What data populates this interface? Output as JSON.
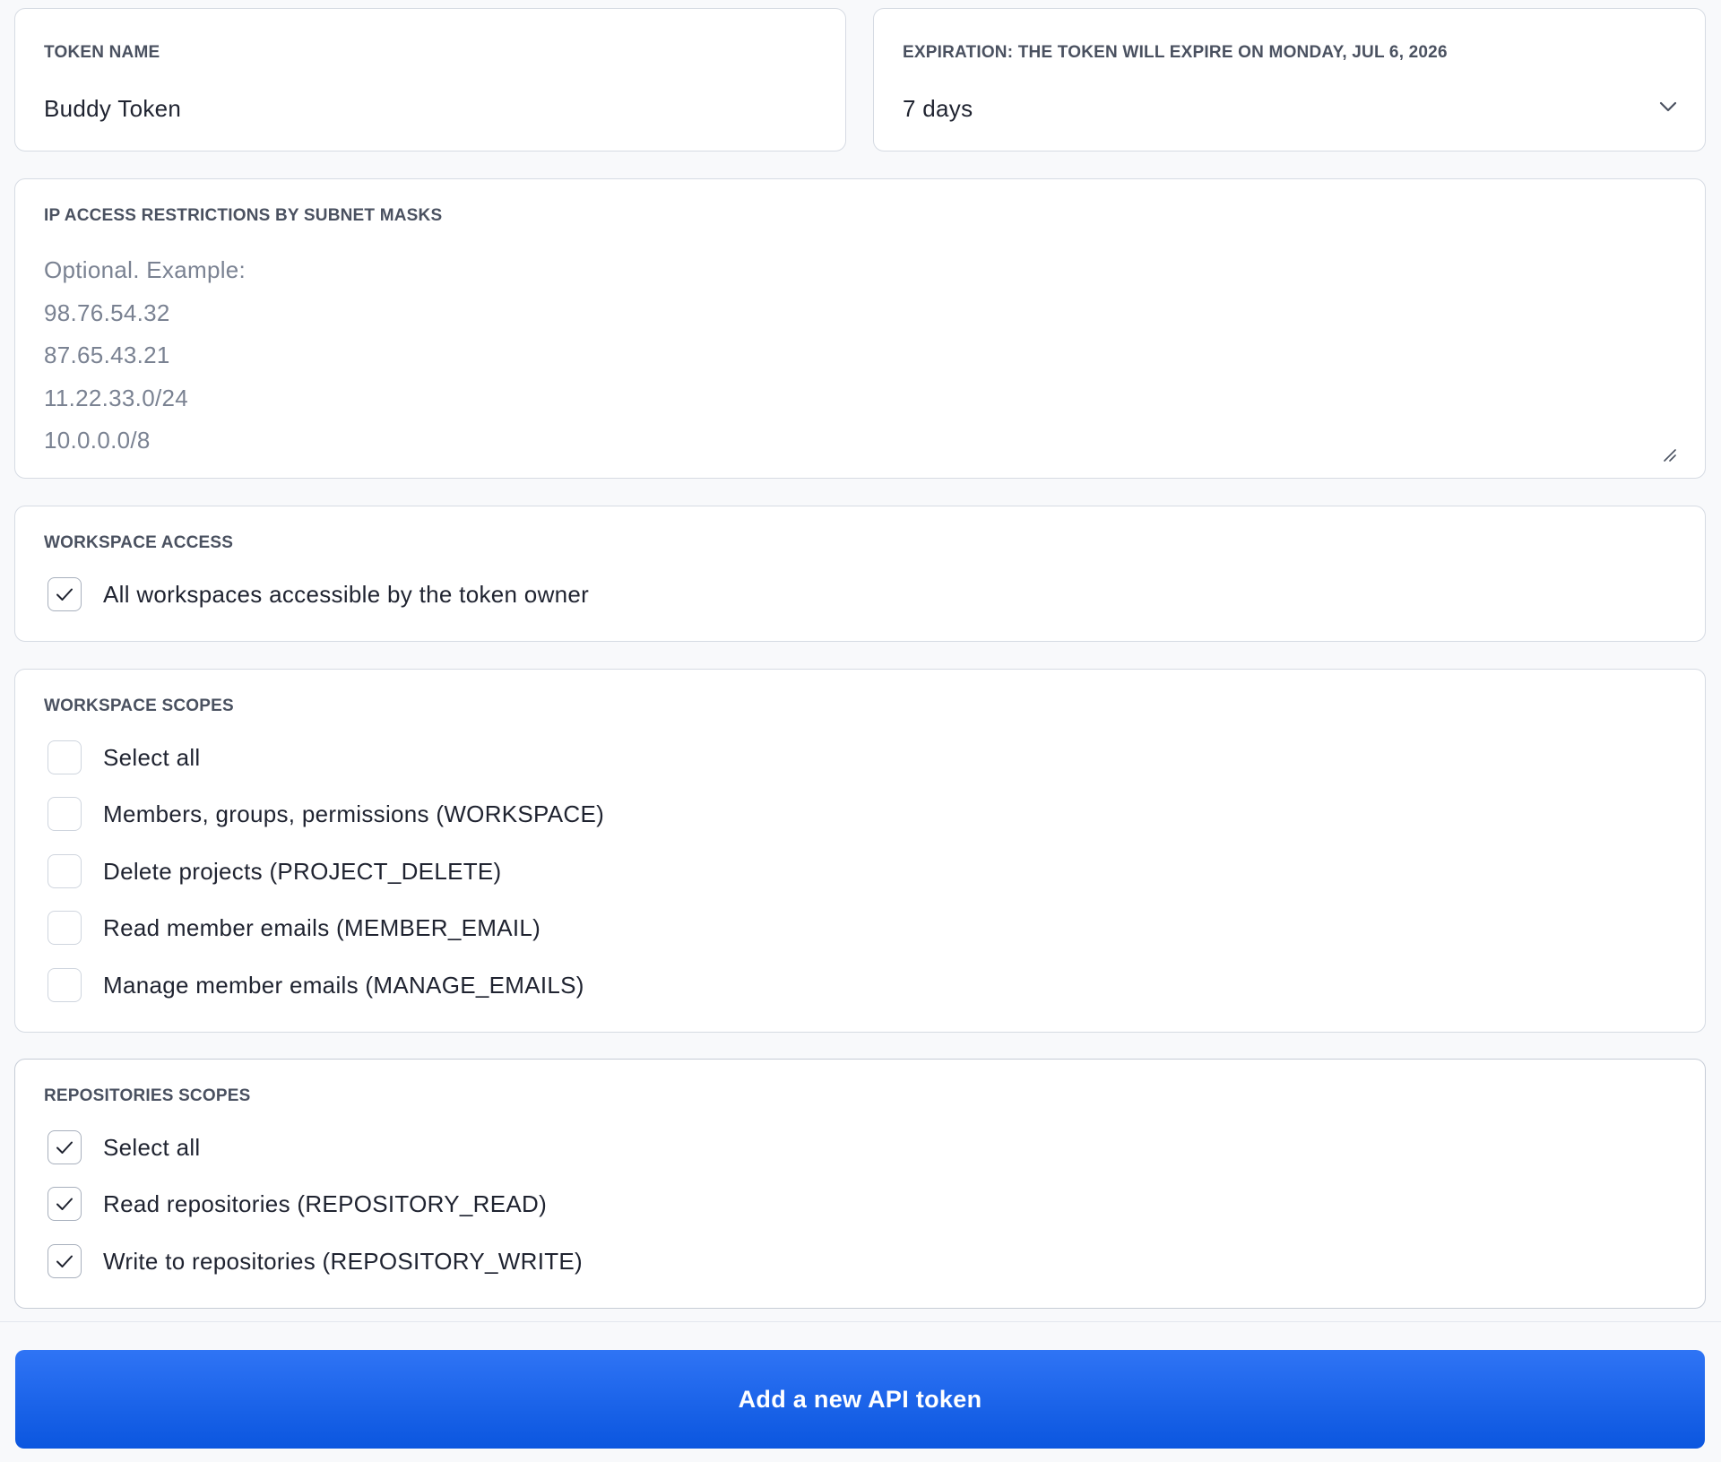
{
  "token_name": {
    "label": "TOKEN NAME",
    "value": "Buddy Token"
  },
  "expiration": {
    "label": "EXPIRATION: THE TOKEN WILL EXPIRE ON MONDAY, JUL 6, 2026",
    "selected": "7 days",
    "icon": "chevron-down-icon"
  },
  "ip_restrictions": {
    "label": "IP ACCESS RESTRICTIONS BY SUBNET MASKS",
    "placeholder_lines": [
      "Optional. Example:",
      "98.76.54.32",
      "87.65.43.21",
      "11.22.33.0/24",
      "10.0.0.0/8"
    ]
  },
  "workspace_access": {
    "label": "WORKSPACE ACCESS",
    "option": {
      "label": "All workspaces accessible by the token owner",
      "checked": true
    }
  },
  "workspace_scopes": {
    "label": "WORKSPACE SCOPES",
    "items": [
      {
        "label": "Select all",
        "checked": false
      },
      {
        "label": "Members, groups, permissions (WORKSPACE)",
        "checked": false
      },
      {
        "label": "Delete projects (PROJECT_DELETE)",
        "checked": false
      },
      {
        "label": "Read member emails (MEMBER_EMAIL)",
        "checked": false
      },
      {
        "label": "Manage member emails (MANAGE_EMAILS)",
        "checked": false
      }
    ]
  },
  "repositories_scopes": {
    "label": "REPOSITORIES SCOPES",
    "items": [
      {
        "label": "Select all",
        "checked": true
      },
      {
        "label": "Read repositories (REPOSITORY_READ)",
        "checked": true
      },
      {
        "label": "Write to repositories (REPOSITORY_WRITE)",
        "checked": true
      }
    ]
  },
  "submit": {
    "label": "Add a new API token"
  },
  "colors": {
    "primary_button": "#1565ec",
    "card_border": "#d6dbe3",
    "label_text": "#4a5160",
    "placeholder_text": "#7a8292"
  }
}
